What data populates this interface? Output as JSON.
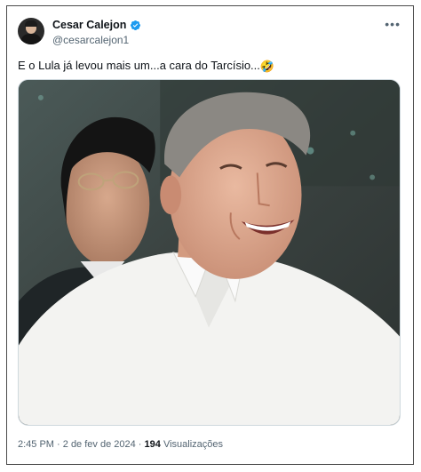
{
  "tweet": {
    "author": {
      "display_name": "Cesar Calejon",
      "handle": "@cesarcalejon1",
      "verified": true,
      "avatar_icon": "profile-photo"
    },
    "more_label": "•••",
    "text": "E o Lula já levou mais um...a cara do Tarcísio...",
    "emoji": "🤣",
    "media": {
      "type": "photo"
    },
    "time": "2:45 PM",
    "separator": "·",
    "date": "2 de fev de 2024",
    "views_count": "194",
    "views_label": "Visualizações"
  },
  "colors": {
    "verified": "#1d9bf0",
    "secondary_text": "#536471",
    "primary_text": "#0f1419"
  }
}
